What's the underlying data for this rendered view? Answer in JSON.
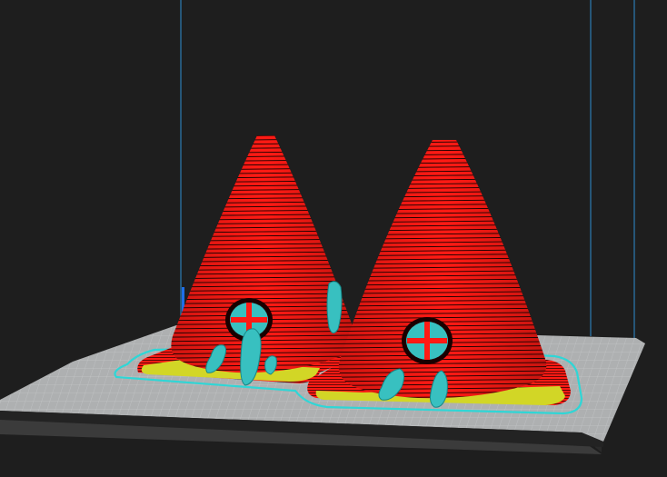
{
  "viewport": {
    "background": "#1e1e1e",
    "colors": {
      "build_volume_line": "#2f8fd0",
      "axis_marker": "#1e6fe8",
      "plate_top": "#aeb0b1",
      "plate_grid": "#c4c6c7",
      "plate_edge": "#2a2a2a",
      "plate_side": "#3b3b3b",
      "outer_wall": "#ff1a14",
      "layer_line": "#1a0000",
      "top_skin": "#d2d626",
      "support": "#38c0c0",
      "support_dark": "#168787",
      "skirt": "#2fd6d6"
    },
    "objects": [
      {
        "name": "cone-left",
        "type": "cone",
        "features": [
          "brim",
          "support-structures",
          "window-opening"
        ]
      },
      {
        "name": "cone-right",
        "type": "cone",
        "features": [
          "brim",
          "support-structures",
          "window-opening"
        ]
      }
    ]
  }
}
